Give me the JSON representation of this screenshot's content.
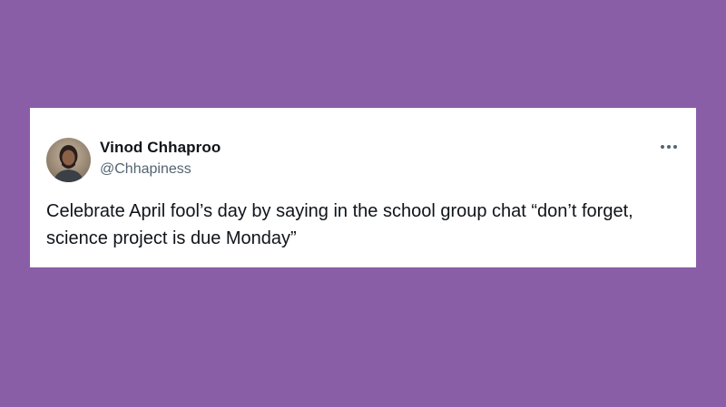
{
  "colors": {
    "background": "#8a5ea6",
    "card": "#ffffff",
    "name_text": "#0f1419",
    "handle_text": "#536471"
  },
  "tweet": {
    "author_name": "Vinod Chhaproo",
    "author_handle": "@Chhapiness",
    "text": "Celebrate April fool’s day by saying in the school group chat “don’t forget, science project is due Monday”",
    "avatar_icon": "user-avatar-photo",
    "more_icon": "more-options-icon"
  }
}
